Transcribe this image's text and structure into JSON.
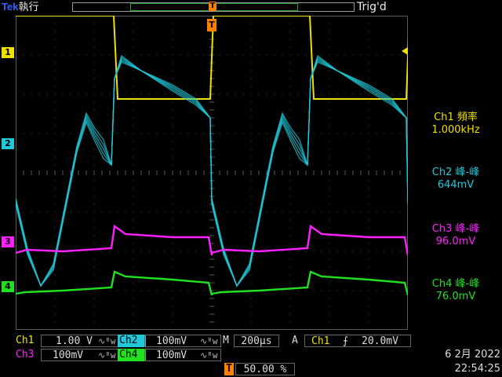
{
  "header": {
    "brand": "Tek",
    "run_state": "執行",
    "trigger_marker": "T",
    "trigger_state": "Trig'd"
  },
  "channel_markers": [
    {
      "label": "1",
      "color": "#f0e000"
    },
    {
      "label": "2",
      "color": "#20c8d8"
    },
    {
      "label": "3",
      "color": "#ff20ff"
    },
    {
      "label": "4",
      "color": "#20e020"
    }
  ],
  "measurements": [
    {
      "name": "Ch1 頻率",
      "value": "1.000kHz",
      "color": "#f0e000"
    },
    {
      "name": "Ch2 峰-峰",
      "value": "644mV",
      "color": "#20c8d8"
    },
    {
      "name": "Ch3 峰-峰",
      "value": "96.0mV",
      "color": "#ff20ff"
    },
    {
      "name": "Ch4 峰-峰",
      "value": "76.0mV",
      "color": "#20e020"
    }
  ],
  "settings": {
    "ch1": {
      "name": "Ch1",
      "scale": "1.00 V",
      "coupling": "∿ᴮw"
    },
    "ch2": {
      "name": "Ch2",
      "scale": "100mV",
      "coupling": "∿ᴮw"
    },
    "ch3": {
      "name": "Ch3",
      "scale": "100mV",
      "coupling": "∿ᴮw"
    },
    "ch4": {
      "name": "Ch4",
      "scale": "100mV",
      "coupling": "∿ᴮw"
    },
    "timebase_label": "M",
    "timebase": "200µs",
    "trigger_mode": "A",
    "trigger_source": "Ch1",
    "trigger_slope": "⨍",
    "trigger_level": "20.0mV",
    "trigger_position_label": "T",
    "trigger_position": "50.00 %"
  },
  "datetime": {
    "date": "6 2月  2022",
    "time": "22:54:25"
  },
  "colors": {
    "ch1": "#f0e000",
    "ch2": "#20c8d8",
    "ch3": "#ff20ff",
    "ch4": "#20e020",
    "trigger": "#ff8000",
    "grid": "#5a5a5a"
  }
}
